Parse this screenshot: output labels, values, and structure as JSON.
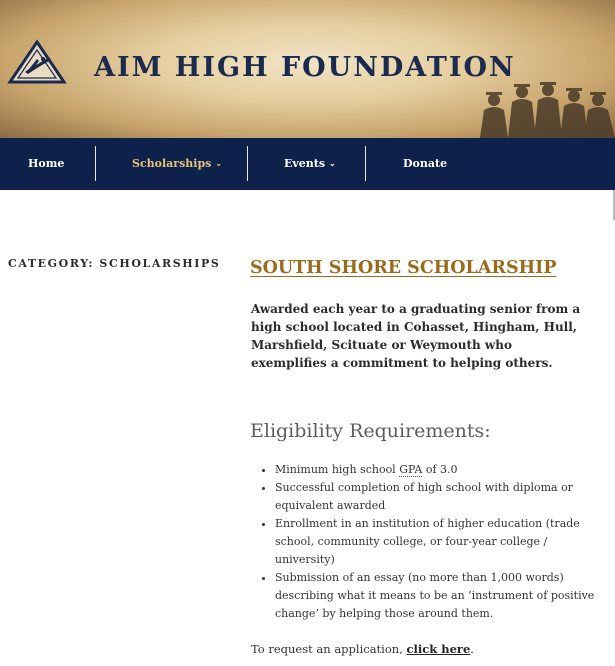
{
  "site": {
    "title": "AIM HIGH FOUNDATION"
  },
  "nav": {
    "items": [
      {
        "label": "Home",
        "caret": ""
      },
      {
        "label": "Scholarships",
        "caret": "⌄"
      },
      {
        "label": "Events",
        "caret": "⌄"
      },
      {
        "label": "Donate",
        "caret": ""
      }
    ]
  },
  "category": {
    "label": "CATEGORY: SCHOLARSHIPS"
  },
  "post": {
    "title": "SOUTH SHORE SCHOLARSHIP",
    "intro": "Awarded each year to a graduating senior from a high school located in Cohasset, Hingham, Hull, Marshfield, Scituate or Weymouth who exemplifies a commitment to helping others.",
    "eligibility_heading": "Eligibility Requirements:",
    "requirements": {
      "gpa_prefix": "Minimum high school ",
      "gpa_abbr": "GPA",
      "gpa_suffix": " of 3.0",
      "item2": "Successful completion of high school with diploma or equivalent awarded",
      "item3": "Enrollment in an institution of higher education (trade school, community college, or four-year college / university)",
      "item4": "Submission of an essay (no more than 1,000 words) describing what it means to be an ‘instrument of positive change’ by helping those around them."
    },
    "request_prefix": "To request an application, ",
    "request_link": "click here",
    "request_suffix": "."
  },
  "colors": {
    "nav_bg": "#0e214a",
    "nav_active": "#e7c27b",
    "title_gold": "#9a6b1d",
    "brand_navy": "#1b2a4f"
  }
}
